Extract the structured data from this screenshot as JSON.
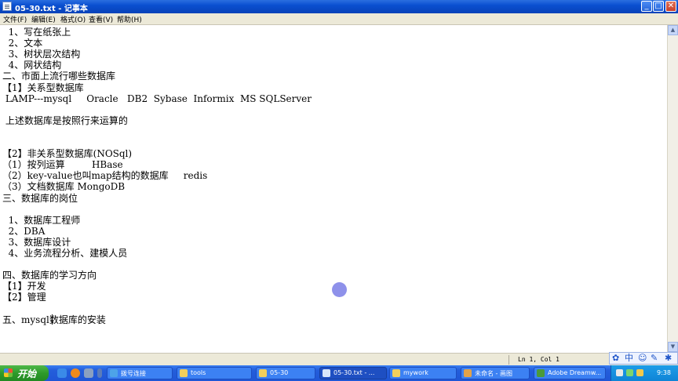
{
  "window": {
    "title": "05-30.txt - 记事本",
    "buttons": [
      "_",
      "□",
      "✕"
    ]
  },
  "menu": [
    "文件(F)",
    "编辑(E)",
    "格式(O)",
    "查看(V)",
    "帮助(H)"
  ],
  "editor": {
    "lines": [
      "  1、写在纸张上",
      "  2、文本",
      "  3、树状层次结构",
      "  4、网状结构",
      "二、市面上流行哪些数据库",
      "【1】关系型数据库",
      " LAMP---mysql     Oracle   DB2  Sybase  Informix  MS SQLServer",
      "",
      " 上述数据库是按照行来运算的",
      "",
      "",
      "【2】非关系型数据库(NOSql)",
      "（1）按列运算         HBase",
      "（2）key-value也叫map结构的数据库     redis",
      "（3）文档数据库 MongoDB",
      "三、数据库的岗位",
      "",
      "  1、数据库工程师",
      "  2、DBA",
      "  3、数据库设计",
      "  4、业务流程分析、建模人员",
      "",
      "四、数据库的学习方向",
      "【1】开发",
      "【2】管理",
      "",
      "五、mysql数据库的安装"
    ]
  },
  "status": {
    "position": "Ln 1, Col 1"
  },
  "ime": {
    "mode": "中"
  },
  "taskbar": {
    "start_label": "开始",
    "tasks": [
      {
        "label": "拨号连接",
        "icon": "network-icon"
      },
      {
        "label": "tools",
        "icon": "folder-icon"
      },
      {
        "label": "05-30",
        "icon": "folder-icon"
      },
      {
        "label": "05-30.txt - ...",
        "icon": "notepad-icon"
      },
      {
        "label": "mywork",
        "icon": "folder-icon"
      },
      {
        "label": "未命名 - 画图",
        "icon": "paint-icon"
      },
      {
        "label": "Adobe Dreamw...",
        "icon": "dreamweaver-icon"
      }
    ],
    "clock": "9:38"
  }
}
